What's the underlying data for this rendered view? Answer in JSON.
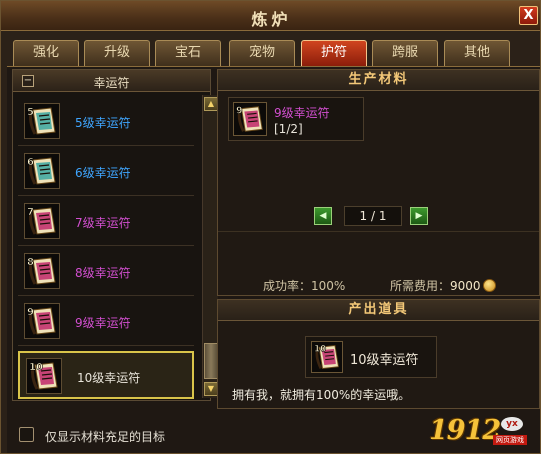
{
  "window": {
    "title": "炼炉",
    "close_label": "X"
  },
  "tabs": [
    {
      "label": "强化",
      "active": false
    },
    {
      "label": "升级",
      "active": false
    },
    {
      "label": "宝石",
      "active": false
    },
    {
      "label": "宠物",
      "active": false
    },
    {
      "label": "护符",
      "active": true
    },
    {
      "label": "跨服",
      "active": false
    },
    {
      "label": "其他",
      "active": false
    }
  ],
  "list": {
    "collapse_symbol": "−",
    "header": "幸运符",
    "items": [
      {
        "level": "5",
        "name": "5级幸运符",
        "color": "#3fa6ff"
      },
      {
        "level": "6",
        "name": "6级幸运符",
        "color": "#3fa6ff"
      },
      {
        "level": "7",
        "name": "7级幸运符",
        "color": "#d24fd0"
      },
      {
        "level": "8",
        "name": "8级幸运符",
        "color": "#d24fd0"
      },
      {
        "level": "9",
        "name": "9级幸运符",
        "color": "#d24fd0"
      },
      {
        "level": "10",
        "name": "10级幸运符",
        "color": "#e8e4da",
        "selected": true
      }
    ],
    "checkbox_label": "仅显示材料充足的目标",
    "checkbox_checked": false
  },
  "materials": {
    "title": "生产材料",
    "item": {
      "level": "9",
      "name": "9级幸运符",
      "count": "[1/2]"
    },
    "pager": {
      "text": "1 / 1"
    },
    "success_rate": "成功率：100%",
    "cost_label": "所需费用：",
    "cost_value": "9000"
  },
  "output": {
    "title": "产出道具",
    "item": {
      "level": "10",
      "name": "10级幸运符"
    },
    "description": "拥有我，就拥有100%的幸运哦。"
  },
  "logo": {
    "number": "1912",
    "badge": "yx",
    "subtitle": "网页游戏"
  },
  "colors": {
    "tab_active": "#c0391a",
    "panel_title": "#f3c878",
    "purple_item": "#d24fd0",
    "blue_item": "#3fa6ff",
    "selected_border": "#d9c44a"
  }
}
